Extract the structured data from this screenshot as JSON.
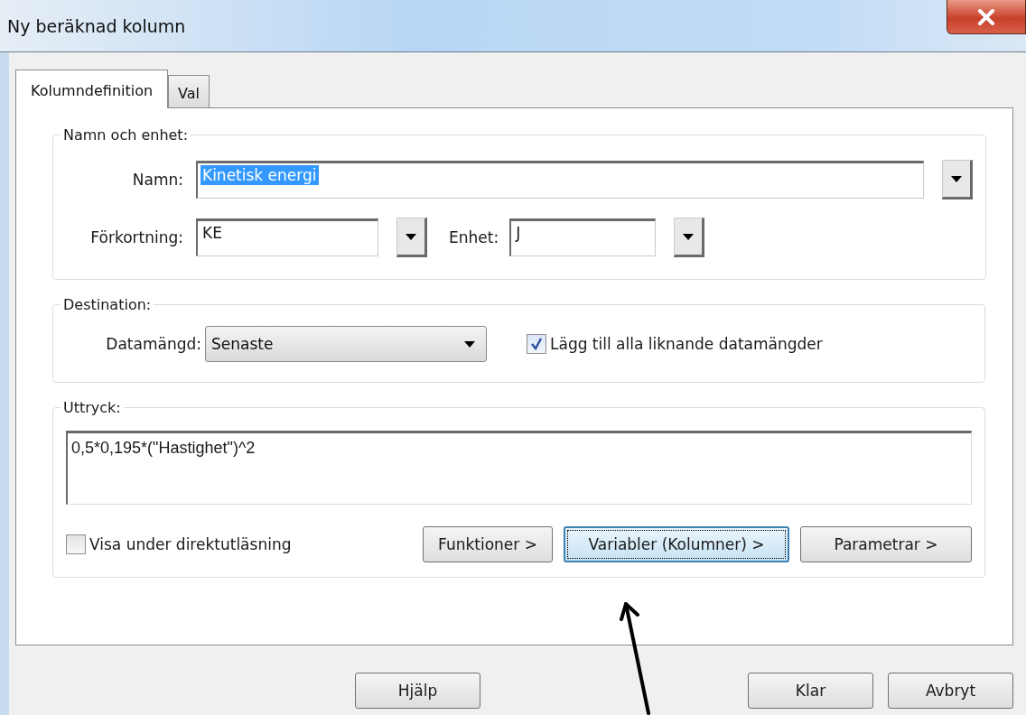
{
  "window": {
    "title": "Ny beräknad kolumn"
  },
  "tabs": [
    {
      "label": "Kolumndefinition",
      "selected": true
    },
    {
      "label": "Val",
      "selected": false
    }
  ],
  "name_unit": {
    "legend": "Namn och enhet:",
    "name": {
      "label": "Namn:",
      "value": "Kinetisk energi",
      "highlighted": true
    },
    "abbreviation": {
      "label": "Förkortning:",
      "value": "KE",
      "highlighted": false
    },
    "unit": {
      "label": "Enhet:",
      "value": "J",
      "highlighted": false
    }
  },
  "destination": {
    "legend": "Destination:",
    "dataset": {
      "label": "Datamängd:",
      "value": "Senaste"
    },
    "add_similar": {
      "label": "Lägg till alla liknande datamängder",
      "checked": true
    }
  },
  "expression": {
    "legend": "Uttryck:",
    "value": "0,5*0,195*(\"Hastighet\")^2",
    "show_live": {
      "label": "Visa under direktutläsning",
      "checked": false
    },
    "buttons": [
      {
        "label": "Funktioner >",
        "focused": false
      },
      {
        "label": "Variabler (Kolumner) >",
        "focused": true
      },
      {
        "label": "Parametrar >",
        "focused": false
      }
    ]
  },
  "footer_buttons": [
    {
      "label": "Hjälp",
      "kind": "help"
    },
    {
      "label": "Klar",
      "kind": "ok"
    },
    {
      "label": "Avbryt",
      "kind": "cancel"
    }
  ]
}
